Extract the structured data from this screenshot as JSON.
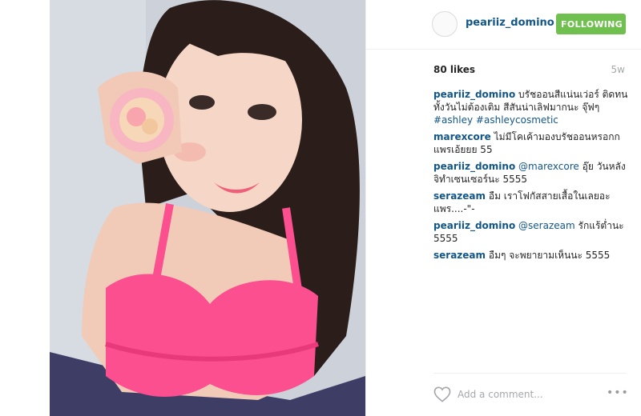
{
  "header": {
    "username": "peariiz_domino",
    "follow_label": "FOLLOWING"
  },
  "stats": {
    "likes": "80 likes",
    "age": "5w"
  },
  "comments": [
    {
      "user": "peariiz_domino",
      "text": "บรัชออนสีแน่นเว่อร์ ติดทนทั้งวันไม่ต้องเติม สีสันน่าเลิฟมากนะ จุ๊ฟๆ",
      "tags": [
        "#ashley",
        "#ashleycosmetic"
      ]
    },
    {
      "user": "marexcore",
      "text": "ไม่มีโคเค้ามองบรัชออนหรอกก แพรเอ้ยยย 55"
    },
    {
      "user": "peariiz_domino",
      "mention": "@marexcore",
      "text": "อุ๊ย วันหลังจิทำเซนเซอร์นะ 5555"
    },
    {
      "user": "serazeam",
      "text": "อืม เราโฟกัสสายเสื้อในเลยอะ แพร....-\"-"
    },
    {
      "user": "peariiz_domino",
      "mention": "@serazeam",
      "text": "รักแร้ต่ำนะ 5555"
    },
    {
      "user": "serazeam",
      "text": "อืมๆ จะพยายามเห็นนะ 5555"
    }
  ],
  "footer": {
    "comment_placeholder": "Add a comment...",
    "more_label": "•••"
  },
  "colors": {
    "username_link": "#125688",
    "follow_button": "#70c050",
    "muted_text": "#a5a7aa"
  }
}
